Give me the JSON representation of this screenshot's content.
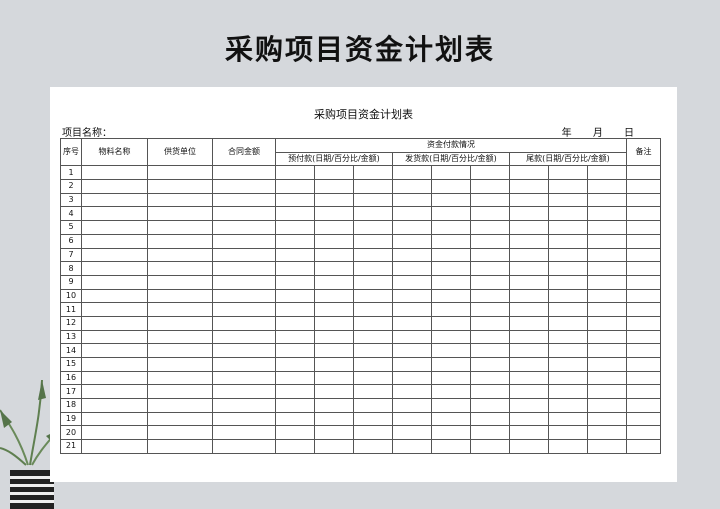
{
  "page_title": "采购项目资金计划表",
  "sheet": {
    "title": "采购项目资金计划表",
    "project_label": "项目名称：",
    "date": {
      "year": "年",
      "month": "月",
      "day": "日"
    }
  },
  "table": {
    "headers": {
      "seq": "序号",
      "material": "物料名称",
      "supplier": "供货单位",
      "contract_amount": "合同金额",
      "payment_group": "资金付款情况",
      "advance": "预付款(日期/百分比/金额)",
      "delivery": "发货款(日期/百分比/金额)",
      "balance": "尾款(日期/百分比/金额)",
      "remark": "备注"
    },
    "rows": [
      "1",
      "2",
      "3",
      "4",
      "5",
      "6",
      "7",
      "8",
      "9",
      "10",
      "11",
      "12",
      "13",
      "14",
      "15",
      "16",
      "17",
      "18",
      "19",
      "20",
      "21"
    ]
  }
}
